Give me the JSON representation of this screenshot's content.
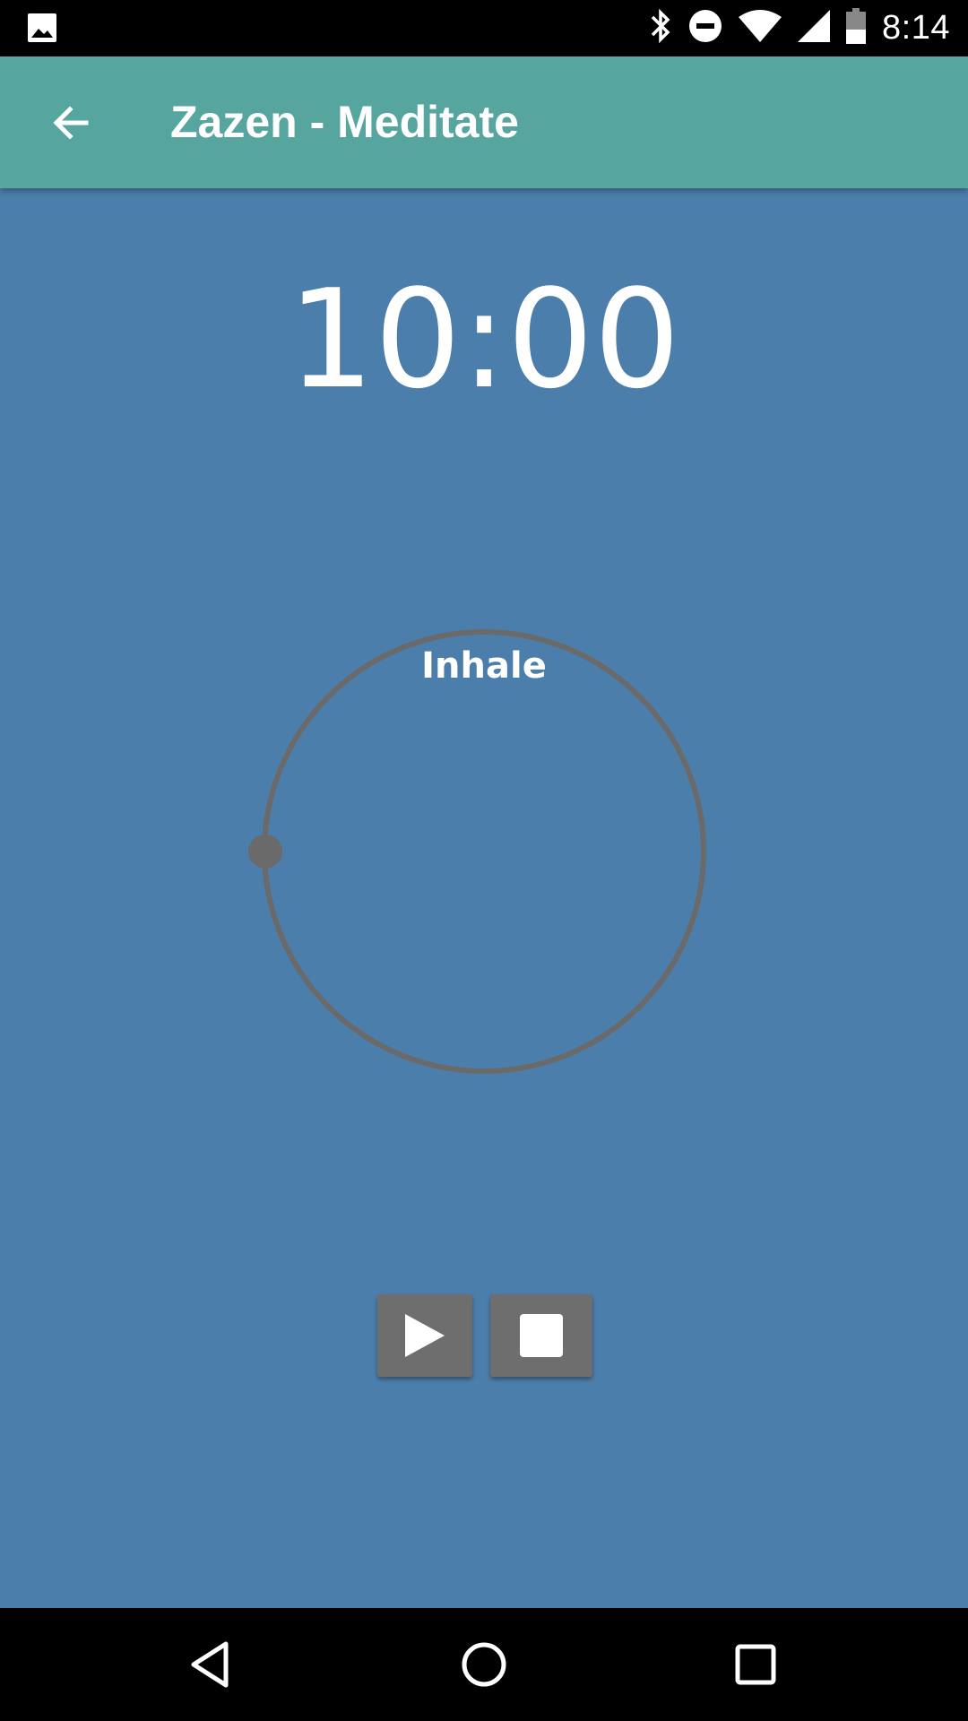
{
  "status_bar": {
    "time": "8:14",
    "icons": [
      "image-icon",
      "bluetooth-icon",
      "do-not-disturb-icon",
      "wifi-icon",
      "signal-icon",
      "battery-icon"
    ]
  },
  "app_bar": {
    "title": "Zazen - Meditate",
    "back_icon": "arrow-back-icon"
  },
  "colors": {
    "app_bar": "#56a69f",
    "background": "#4c7eab",
    "ring": "#6a6a6a",
    "button": "#6e6e6e"
  },
  "meditation": {
    "timer": "10:00",
    "phase": "Inhale"
  },
  "controls": {
    "play_icon": "play-icon",
    "stop_icon": "stop-icon"
  },
  "nav_bar": {
    "icons": [
      "nav-back-icon",
      "nav-home-icon",
      "nav-recents-icon"
    ]
  }
}
